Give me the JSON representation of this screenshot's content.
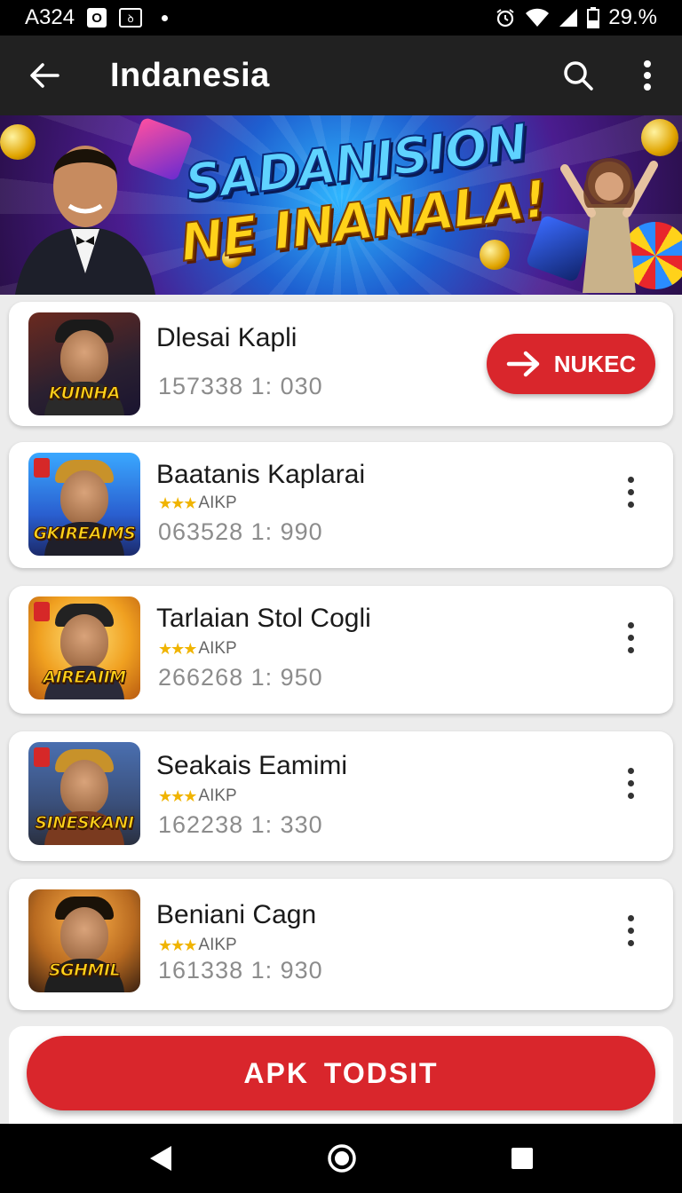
{
  "status_bar": {
    "carrier": "A324",
    "battery": "29.%"
  },
  "app_bar": {
    "title": "Indanesia"
  },
  "banner": {
    "line1": "SADANISION",
    "line2": "NE INANALA!"
  },
  "featured": {
    "name": "Dlesai Kapli",
    "meta": "157338 1: 030",
    "logo": "KUINHA",
    "button_label": "NUKEC"
  },
  "items": [
    {
      "name": "Baatanis Kaplarai",
      "rating_label": "AIKP",
      "meta": "063528 1: 990",
      "logo": "GKIREAIMS"
    },
    {
      "name": "Tarlaian Stol Cogli",
      "rating_label": "AIKP",
      "meta": "266268 1: 950",
      "logo": "AIREAIIM"
    },
    {
      "name": "Seakais Eamimi",
      "rating_label": "AIKP",
      "meta": "162238 1: 330",
      "logo": "SINESKANI"
    },
    {
      "name": "Beniani Cagn",
      "rating_label": "AIKP",
      "meta": "161338 1: 930",
      "logo": "SGHMIL"
    }
  ],
  "primary_action": {
    "label": "APK TODSIT"
  },
  "colors": {
    "accent": "#d9262c",
    "app_bar": "#212121",
    "star": "#f0b400"
  }
}
